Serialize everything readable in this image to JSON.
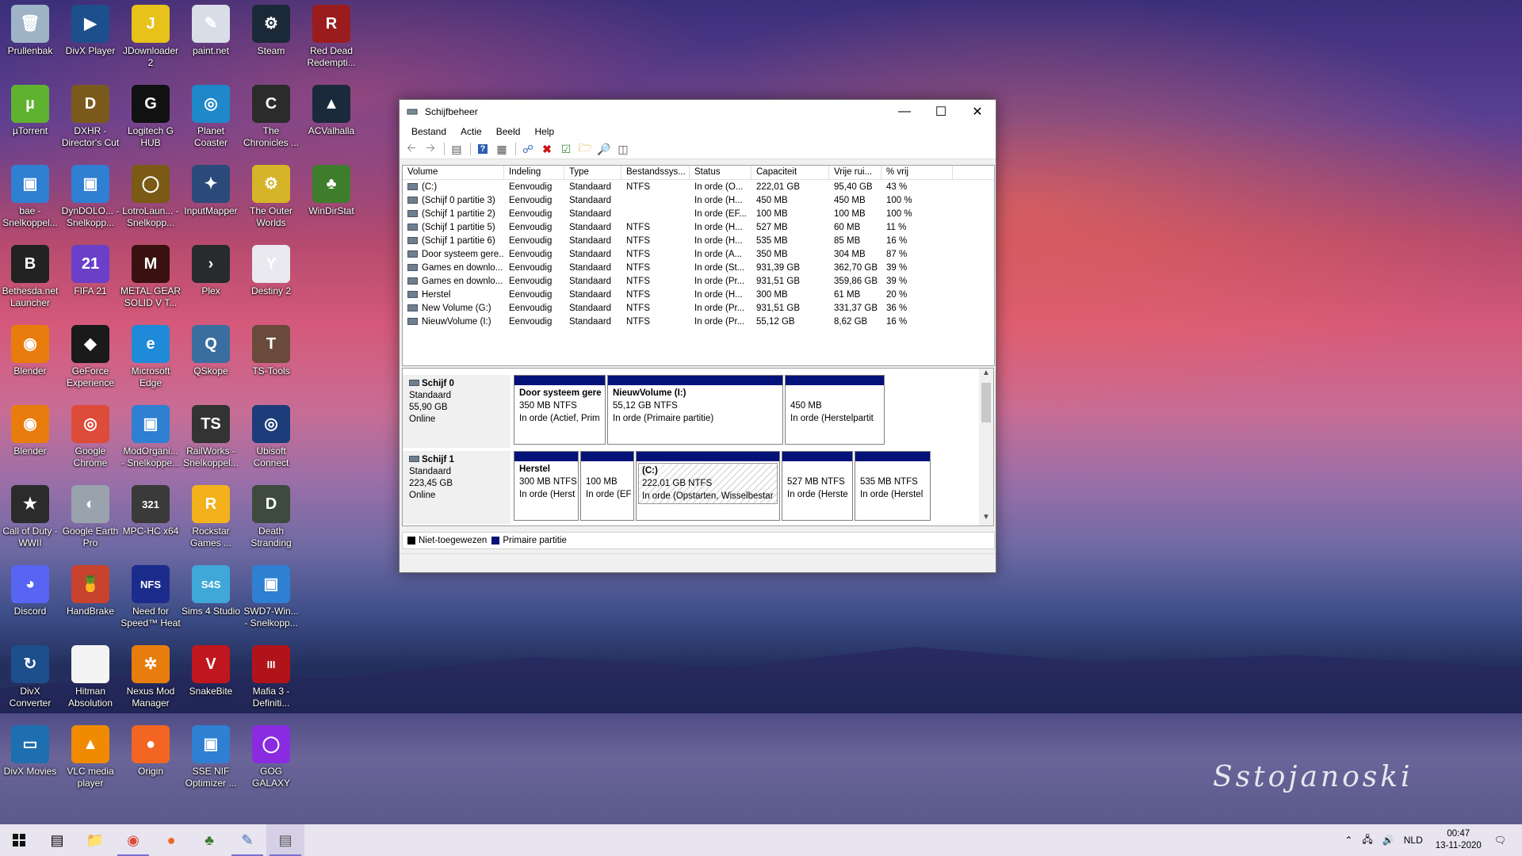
{
  "desktop": {
    "icons": [
      {
        "label": "Prullenbak",
        "icon": "recycle-bin-icon",
        "color": "#9fb3c7",
        "glyph": "🗑"
      },
      {
        "label": "DivX Player",
        "icon": "divx-player-icon",
        "color": "#1d4f8c",
        "glyph": "▶"
      },
      {
        "label": "JDownloader 2",
        "icon": "jdownloader-icon",
        "color": "#e6c21a",
        "glyph": "J"
      },
      {
        "label": "paint.net",
        "icon": "paintnet-icon",
        "color": "#d8dde8",
        "glyph": "✎"
      },
      {
        "label": "Steam",
        "icon": "steam-icon",
        "color": "#1b2838",
        "glyph": "⚙"
      },
      {
        "label": "Red Dead Redempti...",
        "icon": "red-dead-icon",
        "color": "#9b1c1c",
        "glyph": "R"
      },
      {
        "label": "µTorrent",
        "icon": "utorrent-icon",
        "color": "#5fb130",
        "glyph": "µ"
      },
      {
        "label": "DXHR - Director's Cut",
        "icon": "dxhr-icon",
        "color": "#7a5a1c",
        "glyph": "D"
      },
      {
        "label": "Logitech G HUB",
        "icon": "logitech-icon",
        "color": "#111111",
        "glyph": "G"
      },
      {
        "label": "Planet Coaster",
        "icon": "planet-coaster-icon",
        "color": "#1e88c9",
        "glyph": "◎"
      },
      {
        "label": "The Chronicles ...",
        "icon": "chronicles-icon",
        "color": "#2b2b2b",
        "glyph": "C"
      },
      {
        "label": "ACValhalla",
        "icon": "ac-valhalla-icon",
        "color": "#1a2a3a",
        "glyph": "▲"
      },
      {
        "label": "bae - Snelkoppel...",
        "icon": "shortcut-app-icon",
        "color": "#2f7fd2",
        "glyph": "▣"
      },
      {
        "label": "DynDOLO... - Snelkopp...",
        "icon": "shortcut-app-icon",
        "color": "#2f7fd2",
        "glyph": "▣"
      },
      {
        "label": "LotroLaun... - Snelkopp...",
        "icon": "lotro-icon",
        "color": "#7a5a14",
        "glyph": "◯"
      },
      {
        "label": "InputMapper",
        "icon": "inputmapper-icon",
        "color": "#2b4a7a",
        "glyph": "✦"
      },
      {
        "label": "The Outer Worlds",
        "icon": "outer-worlds-icon",
        "color": "#d6b429",
        "glyph": "⚙"
      },
      {
        "label": "WinDirStat",
        "icon": "windirstat-icon",
        "color": "#3e7d2c",
        "glyph": "♣"
      },
      {
        "label": "Bethesda.net Launcher",
        "icon": "bethesda-icon",
        "color": "#222222",
        "glyph": "B"
      },
      {
        "label": "FIFA 21",
        "icon": "fifa-icon",
        "color": "#6b3fc8",
        "glyph": "21"
      },
      {
        "label": "METAL GEAR SOLID V T...",
        "icon": "mgsv-icon",
        "color": "#3a1010",
        "glyph": "M"
      },
      {
        "label": "Plex",
        "icon": "plex-icon",
        "color": "#282a2d",
        "glyph": "›"
      },
      {
        "label": "Destiny 2",
        "icon": "destiny-icon",
        "color": "#e9e9ef",
        "glyph": "Y"
      },
      {
        "label": "",
        "icon": "",
        "color": "",
        "glyph": ""
      },
      {
        "label": "Blender",
        "icon": "blender-icon",
        "color": "#e87d0d",
        "glyph": "◉"
      },
      {
        "label": "GeForce Experience",
        "icon": "geforce-icon",
        "color": "#1a1a1a",
        "glyph": "◆"
      },
      {
        "label": "Microsoft Edge",
        "icon": "edge-icon",
        "color": "#1f8ad8",
        "glyph": "e"
      },
      {
        "label": "QSkope",
        "icon": "qskope-icon",
        "color": "#3b6ea0",
        "glyph": "Q"
      },
      {
        "label": "TS-Tools",
        "icon": "ts-tools-icon",
        "color": "#6a4a3a",
        "glyph": "T"
      },
      {
        "label": "",
        "icon": "",
        "color": "",
        "glyph": ""
      },
      {
        "label": "Blender",
        "icon": "blender-icon",
        "color": "#e87d0d",
        "glyph": "◉"
      },
      {
        "label": "Google Chrome",
        "icon": "chrome-icon",
        "color": "#dd4b39",
        "glyph": "◎"
      },
      {
        "label": "ModOrgani... - Snelkoppe...",
        "icon": "shortcut-app-icon",
        "color": "#2f7fd2",
        "glyph": "▣"
      },
      {
        "label": "RailWorks - Snelkoppel...",
        "icon": "railworks-icon",
        "color": "#333333",
        "glyph": "TS"
      },
      {
        "label": "Ubisoft Connect",
        "icon": "ubisoft-icon",
        "color": "#1d3c7a",
        "glyph": "◎"
      },
      {
        "label": "",
        "icon": "",
        "color": "",
        "glyph": ""
      },
      {
        "label": "Call of Duty - WWII",
        "icon": "cod-icon",
        "color": "#2b2b2b",
        "glyph": "★"
      },
      {
        "label": "Google Earth Pro",
        "icon": "google-earth-icon",
        "color": "#9aa3ad",
        "glyph": "◐"
      },
      {
        "label": "MPC-HC x64",
        "icon": "mpc-hc-icon",
        "color": "#3a3a3a",
        "glyph": "321"
      },
      {
        "label": "Rockstar Games ...",
        "icon": "rockstar-icon",
        "color": "#f3b21b",
        "glyph": "R"
      },
      {
        "label": "Death Stranding",
        "icon": "death-stranding-icon",
        "color": "#3d4a3d",
        "glyph": "D"
      },
      {
        "label": "",
        "icon": "",
        "color": "",
        "glyph": ""
      },
      {
        "label": "Discord",
        "icon": "discord-icon",
        "color": "#5865f2",
        "glyph": "◕"
      },
      {
        "label": "HandBrake",
        "icon": "handbrake-icon",
        "color": "#c9422d",
        "glyph": "🍍"
      },
      {
        "label": "Need for Speed™ Heat",
        "icon": "nfs-icon",
        "color": "#1c2c8c",
        "glyph": "NFS"
      },
      {
        "label": "Sims 4 Studio",
        "icon": "sims4studio-icon",
        "color": "#3fa8d8",
        "glyph": "S4S"
      },
      {
        "label": "SWD7-Win... - Snelkopp...",
        "icon": "shortcut-app-icon",
        "color": "#2f7fd2",
        "glyph": "▣"
      },
      {
        "label": "",
        "icon": "",
        "color": "",
        "glyph": ""
      },
      {
        "label": "DivX Converter",
        "icon": "divx-converter-icon",
        "color": "#1d4f8c",
        "glyph": "↻"
      },
      {
        "label": "Hitman Absolution",
        "icon": "file-icon",
        "color": "#f4f4f4",
        "glyph": ""
      },
      {
        "label": "Nexus Mod Manager",
        "icon": "nexus-icon",
        "color": "#e87d0d",
        "glyph": "✲"
      },
      {
        "label": "SnakeBite",
        "icon": "snakebite-icon",
        "color": "#c0161d",
        "glyph": "V"
      },
      {
        "label": "Mafia 3 - Definiti...",
        "icon": "mafia-icon",
        "color": "#b0141a",
        "glyph": "III"
      },
      {
        "label": "",
        "icon": "",
        "color": "",
        "glyph": ""
      },
      {
        "label": "DivX Movies",
        "icon": "divx-movies-icon",
        "color": "#1d6fb0",
        "glyph": "▭"
      },
      {
        "label": "VLC media player",
        "icon": "vlc-icon",
        "color": "#f08a00",
        "glyph": "▲"
      },
      {
        "label": "Origin",
        "icon": "origin-icon",
        "color": "#f26522",
        "glyph": "●"
      },
      {
        "label": "SSE NIF Optimizer ...",
        "icon": "shortcut-app-icon",
        "color": "#2f7fd2",
        "glyph": "▣"
      },
      {
        "label": "GOG GALAXY",
        "icon": "gog-icon",
        "color": "#8a2be2",
        "glyph": "◯"
      }
    ]
  },
  "window": {
    "title": "Schijfbeheer",
    "menu": [
      "Bestand",
      "Actie",
      "Beeld",
      "Help"
    ],
    "columns": [
      "Volume",
      "Indeling",
      "Type",
      "Bestandssys...",
      "Status",
      "Capaciteit",
      "Vrije rui...",
      "% vrij"
    ],
    "rows": [
      [
        "(C:)",
        "Eenvoudig",
        "Standaard",
        "NTFS",
        "In orde (O...",
        "222,01 GB",
        "95,40 GB",
        "43 %"
      ],
      [
        "(Schijf 0 partitie 3)",
        "Eenvoudig",
        "Standaard",
        "",
        "In orde (H...",
        "450 MB",
        "450 MB",
        "100 %"
      ],
      [
        "(Schijf 1 partitie 2)",
        "Eenvoudig",
        "Standaard",
        "",
        "In orde (EF...",
        "100 MB",
        "100 MB",
        "100 %"
      ],
      [
        "(Schijf 1 partitie 5)",
        "Eenvoudig",
        "Standaard",
        "NTFS",
        "In orde (H...",
        "527 MB",
        "60 MB",
        "11 %"
      ],
      [
        "(Schijf 1 partitie 6)",
        "Eenvoudig",
        "Standaard",
        "NTFS",
        "In orde (H...",
        "535 MB",
        "85 MB",
        "16 %"
      ],
      [
        "Door systeem gere...",
        "Eenvoudig",
        "Standaard",
        "NTFS",
        "In orde (A...",
        "350 MB",
        "304 MB",
        "87 %"
      ],
      [
        "Games en downlo...",
        "Eenvoudig",
        "Standaard",
        "NTFS",
        "In orde (St...",
        "931,39 GB",
        "362,70 GB",
        "39 %"
      ],
      [
        "Games en downlo...",
        "Eenvoudig",
        "Standaard",
        "NTFS",
        "In orde (Pr...",
        "931,51 GB",
        "359,86 GB",
        "39 %"
      ],
      [
        "Herstel",
        "Eenvoudig",
        "Standaard",
        "NTFS",
        "In orde (H...",
        "300 MB",
        "61 MB",
        "20 %"
      ],
      [
        "New Volume (G:)",
        "Eenvoudig",
        "Standaard",
        "NTFS",
        "In orde (Pr...",
        "931,51 GB",
        "331,37 GB",
        "36 %"
      ],
      [
        "NieuwVolume (I:)",
        "Eenvoudig",
        "Standaard",
        "NTFS",
        "In orde (Pr...",
        "55,12 GB",
        "8,62 GB",
        "16 %"
      ]
    ],
    "disks": [
      {
        "name": "Schijf 0",
        "type": "Standaard",
        "size": "55,90 GB",
        "state": "Online",
        "parts": [
          {
            "name": "Door systeem gere",
            "size": "350 MB NTFS",
            "status": "In orde (Actief, Prim"
          },
          {
            "name": "NieuwVolume  (I:)",
            "size": "55,12 GB NTFS",
            "status": "In orde (Primaire partitie)"
          },
          {
            "name": "",
            "size": "450 MB",
            "status": "In orde (Herstelpartit"
          }
        ]
      },
      {
        "name": "Schijf 1",
        "type": "Standaard",
        "size": "223,45 GB",
        "state": "Online",
        "parts": [
          {
            "name": "Herstel",
            "size": "300 MB NTFS",
            "status": "In orde (Herst"
          },
          {
            "name": "",
            "size": "100 MB",
            "status": "In orde (EF"
          },
          {
            "name": "(C:)",
            "size": "222,01 GB NTFS",
            "status": "In orde (Opstarten, Wisselbestar"
          },
          {
            "name": "",
            "size": "527 MB NTFS",
            "status": "In orde (Herste"
          },
          {
            "name": "",
            "size": "535 MB NTFS",
            "status": "In orde (Herstel"
          }
        ]
      }
    ],
    "legend": [
      {
        "label": "Niet-toegewezen",
        "color": "#000000"
      },
      {
        "label": "Primaire partitie",
        "color": "#05127a"
      }
    ]
  },
  "taskbar": {
    "language": "NLD",
    "time": "00:47",
    "date": "13-11-2020"
  },
  "signature": "Sstojanoski"
}
